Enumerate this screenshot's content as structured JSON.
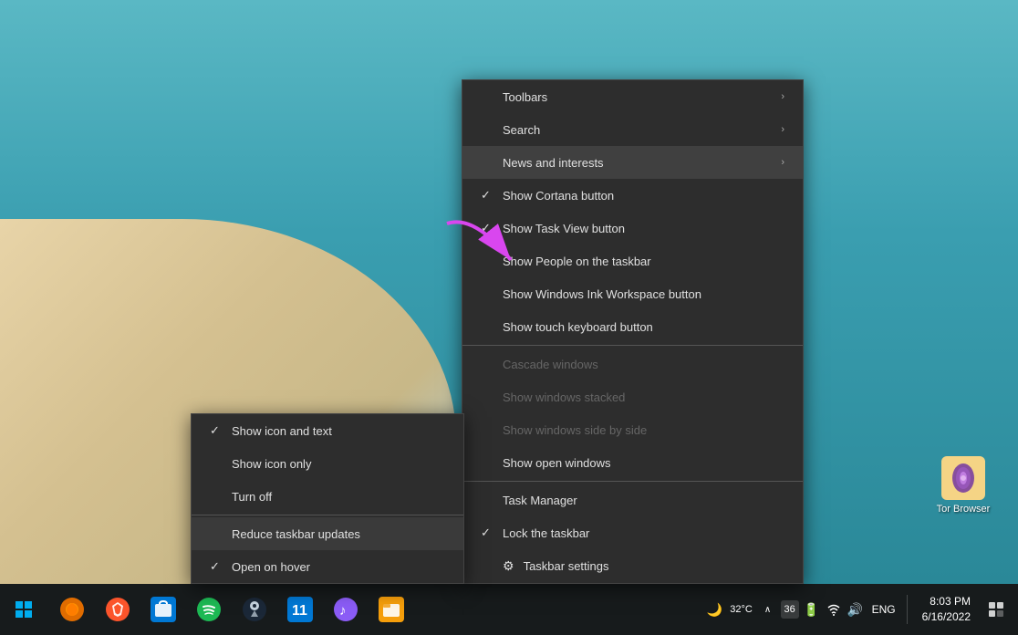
{
  "desktop": {
    "icon": {
      "name": "Tor Browser",
      "label": "Tor Browser"
    }
  },
  "main_menu": {
    "items": [
      {
        "id": "toolbars",
        "label": "Toolbars",
        "check": "",
        "hasArrow": true,
        "disabled": false,
        "hasSeparator": false
      },
      {
        "id": "search",
        "label": "Search",
        "check": "",
        "hasArrow": true,
        "disabled": false,
        "hasSeparator": false
      },
      {
        "id": "news",
        "label": "News and interests",
        "check": "",
        "hasArrow": true,
        "disabled": false,
        "highlighted": true,
        "hasSeparator": false
      },
      {
        "id": "cortana",
        "label": "Show Cortana button",
        "check": "✓",
        "hasArrow": false,
        "disabled": false,
        "hasSeparator": false
      },
      {
        "id": "taskview",
        "label": "Show Task View button",
        "check": "✓",
        "hasArrow": false,
        "disabled": false,
        "hasSeparator": false
      },
      {
        "id": "people",
        "label": "Show People on the taskbar",
        "check": "",
        "hasArrow": false,
        "disabled": false,
        "hasSeparator": false
      },
      {
        "id": "ink",
        "label": "Show Windows Ink Workspace button",
        "check": "",
        "hasArrow": false,
        "disabled": false,
        "hasSeparator": false
      },
      {
        "id": "touch",
        "label": "Show touch keyboard button",
        "check": "",
        "hasArrow": false,
        "disabled": false,
        "hasSeparator": true
      },
      {
        "id": "cascade",
        "label": "Cascade windows",
        "check": "",
        "hasArrow": false,
        "disabled": true,
        "hasSeparator": false
      },
      {
        "id": "stacked",
        "label": "Show windows stacked",
        "check": "",
        "hasArrow": false,
        "disabled": true,
        "hasSeparator": false
      },
      {
        "id": "sidebyside",
        "label": "Show windows side by side",
        "check": "",
        "hasArrow": false,
        "disabled": true,
        "hasSeparator": false
      },
      {
        "id": "openwindows",
        "label": "Show open windows",
        "check": "",
        "hasArrow": false,
        "disabled": false,
        "hasSeparator": true
      },
      {
        "id": "taskmanager",
        "label": "Task Manager",
        "check": "",
        "hasArrow": false,
        "disabled": false,
        "hasSeparator": false
      },
      {
        "id": "lock",
        "label": "Lock the taskbar",
        "check": "✓",
        "hasArrow": false,
        "disabled": false,
        "hasSeparator": false
      },
      {
        "id": "settings",
        "label": "Taskbar settings",
        "check": "",
        "hasArrow": false,
        "disabled": false,
        "isSettings": true,
        "hasSeparator": false
      }
    ]
  },
  "sub_menu": {
    "items": [
      {
        "id": "show-icon-text",
        "label": "Show icon and text",
        "check": "✓",
        "hasSeparator": false
      },
      {
        "id": "show-icon-only",
        "label": "Show icon only",
        "check": "",
        "hasSeparator": false
      },
      {
        "id": "turn-off",
        "label": "Turn off",
        "check": "",
        "hasSeparator": true
      },
      {
        "id": "reduce-updates",
        "label": "Reduce taskbar updates",
        "check": "",
        "highlighted": true,
        "hasSeparator": false
      },
      {
        "id": "open-hover",
        "label": "Open on hover",
        "check": "✓",
        "hasSeparator": false
      }
    ]
  },
  "taskbar": {
    "start_icon": "⊞",
    "apps": [
      {
        "id": "firefox",
        "label": "Firefox",
        "color": "#e06c00"
      },
      {
        "id": "brave",
        "label": "Brave",
        "color": "#fb542b"
      },
      {
        "id": "store",
        "label": "Microsoft Store",
        "color": "#0078d4"
      },
      {
        "id": "spotify",
        "label": "Spotify",
        "color": "#1db954"
      },
      {
        "id": "steam",
        "label": "Steam",
        "color": "#1b2838"
      },
      {
        "id": "windows11",
        "label": "Windows 11",
        "color": "#0078d4"
      },
      {
        "id": "music",
        "label": "Music",
        "color": "#8b5cf6"
      },
      {
        "id": "files",
        "label": "Files",
        "color": "#f59e0b"
      }
    ],
    "system": {
      "temperature": "32°C",
      "battery_icon": "🔋",
      "wifi_icon": "📶",
      "volume_icon": "🔊",
      "language": "ENG",
      "time": "8:03 PM",
      "date": "6/16/2022",
      "moon_icon": "🌙"
    }
  }
}
